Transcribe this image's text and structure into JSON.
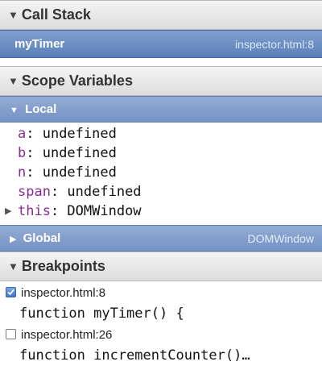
{
  "call_stack": {
    "title": "Call Stack",
    "frames": [
      {
        "function": "myTimer",
        "location": "inspector.html:8"
      }
    ]
  },
  "scope_variables": {
    "title": "Scope Variables",
    "local": {
      "label": "Local",
      "vars": [
        {
          "name": "a",
          "value": ": undefined"
        },
        {
          "name": "b",
          "value": ": undefined"
        },
        {
          "name": "n",
          "value": ": undefined"
        },
        {
          "name": "span",
          "value": ": undefined"
        },
        {
          "name": "this",
          "value": ": DOMWindow"
        }
      ]
    },
    "global": {
      "label": "Global",
      "value": "DOMWindow"
    }
  },
  "breakpoints": {
    "title": "Breakpoints",
    "items": [
      {
        "location": "inspector.html:8",
        "code": "function myTimer() {",
        "checked": true
      },
      {
        "location": "inspector.html:26",
        "code": "function incrementCounter()…",
        "checked": false
      }
    ]
  },
  "icons": {
    "expanded": "triangle-down-icon",
    "collapsed": "triangle-right-icon",
    "checkbox_checked": "checkbox-checked-icon",
    "checkbox_unchecked": "checkbox-unchecked-icon"
  }
}
